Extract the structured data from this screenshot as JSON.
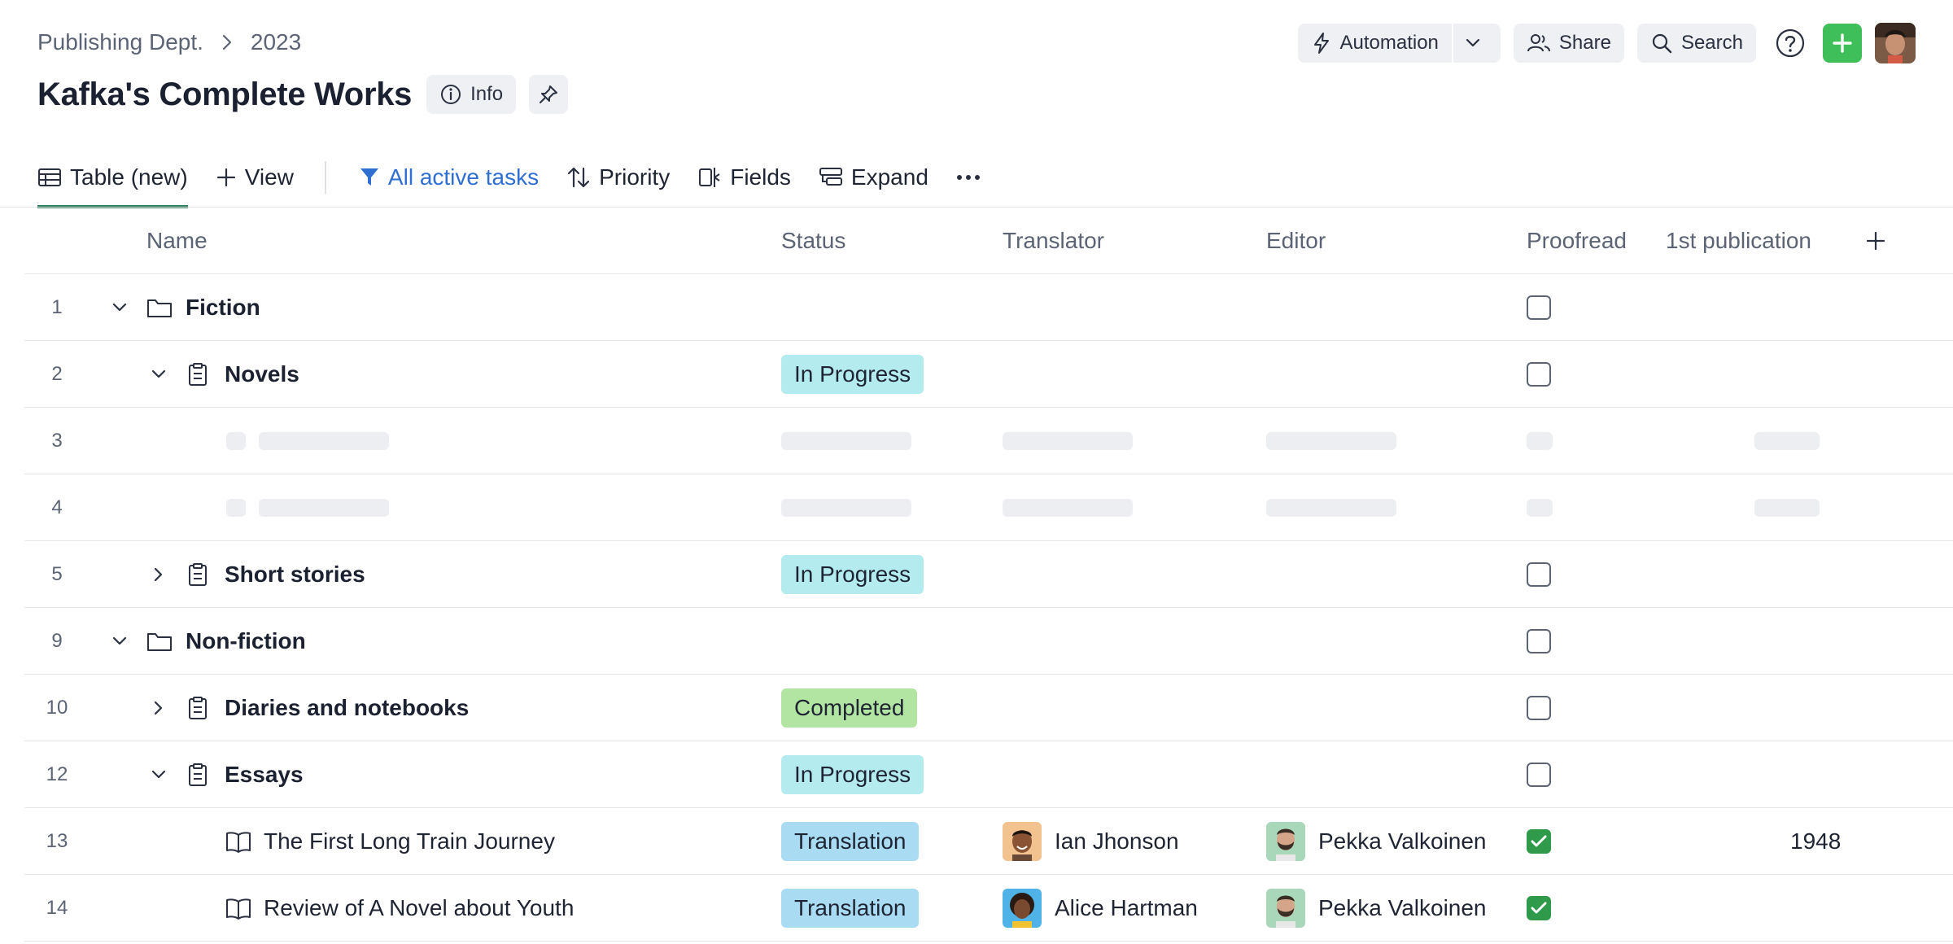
{
  "breadcrumb": {
    "dept": "Publishing Dept.",
    "year": "2023"
  },
  "page": {
    "title": "Kafka's Complete Works",
    "info_label": "Info"
  },
  "actions": {
    "automation": "Automation",
    "share": "Share",
    "search": "Search"
  },
  "viewbar": {
    "table": "Table (new)",
    "view": "View",
    "filter": "All active tasks",
    "priority": "Priority",
    "fields": "Fields",
    "expand": "Expand"
  },
  "columns": {
    "name": "Name",
    "status": "Status",
    "translator": "Translator",
    "editor": "Editor",
    "proofread": "Proofread",
    "pub": "1st publication"
  },
  "rows": [
    {
      "num": "1",
      "name": "Fiction",
      "status": "",
      "proofread": false
    },
    {
      "num": "2",
      "name": "Novels",
      "status": "In Progress",
      "proofread": false
    },
    {
      "num": "3"
    },
    {
      "num": "4"
    },
    {
      "num": "5",
      "name": "Short stories",
      "status": "In Progress",
      "proofread": false
    },
    {
      "num": "9",
      "name": "Non-fiction",
      "status": "",
      "proofread": false
    },
    {
      "num": "10",
      "name": "Diaries and notebooks",
      "status": "Completed",
      "proofread": false
    },
    {
      "num": "12",
      "name": "Essays",
      "status": "In Progress",
      "proofread": false
    },
    {
      "num": "13",
      "name": "The First Long Train Journey",
      "status": "Translation",
      "translator": "Ian Jhonson",
      "editor": "Pekka Valkoinen",
      "proofread": true,
      "pub": "1948"
    },
    {
      "num": "14",
      "name": "Review of A Novel about Youth",
      "status": "Translation",
      "translator": "Alice Hartman",
      "editor": "Pekka Valkoinen",
      "proofread": true,
      "pub": ""
    }
  ],
  "colors": {
    "in_progress": "#b3ebee",
    "completed": "#b2e5a2",
    "translation": "#a9dcf2",
    "accent_green": "#3fbf5a",
    "filter_blue": "#2f6fd1"
  }
}
